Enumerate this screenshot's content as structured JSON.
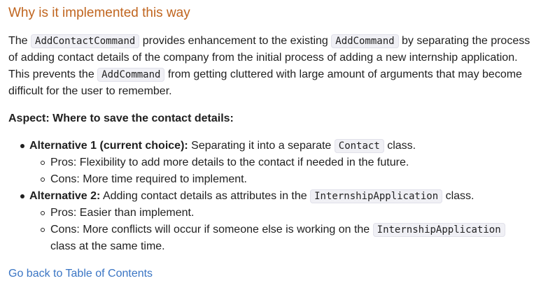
{
  "heading": "Why is it implemented this way",
  "paragraph": {
    "t1": "The ",
    "c1": "AddContactCommand",
    "t2": " provides enhancement to the existing ",
    "c2": "AddCommand",
    "t3": " by separating the process of adding contact details of the company from the initial process of adding a new internship application. This prevents the ",
    "c3": "AddCommand",
    "t4": " from getting cluttered with large amount of arguments that may become difficult for the user to remember."
  },
  "aspect": "Aspect: Where to save the contact details:",
  "alternatives": [
    {
      "label": "Alternative 1 (current choice):",
      "pre": " Separating it into a separate ",
      "code": "Contact",
      "post": " class.",
      "pros": "Pros: Flexibility to add more details to the contact if needed in the future.",
      "cons": "Cons: More time required to implement."
    },
    {
      "label": "Alternative 2:",
      "pre": " Adding contact details as attributes in the ",
      "code": "InternshipApplication",
      "post": " class.",
      "pros": "Pros: Easier than implement.",
      "cons_pre": "Cons: More conflicts will occur if someone else is working on the ",
      "cons_code": "InternshipApplication",
      "cons_post": " class at the same time."
    }
  ],
  "back_link": "Go back to Table of Contents"
}
